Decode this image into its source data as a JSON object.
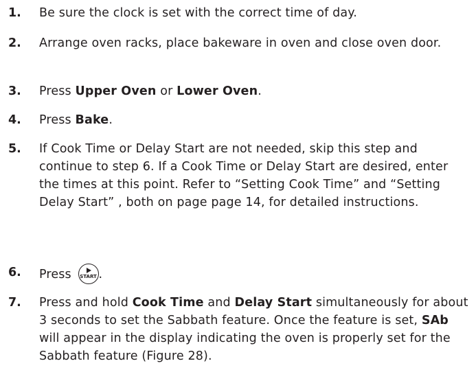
{
  "steps": [
    {
      "number": "1.",
      "text": "Be sure the clock is set with the correct time of day."
    },
    {
      "number": "2.",
      "text": "Arrange oven racks, place bakeware in oven and close oven door."
    },
    {
      "number": "3.",
      "text_before": "Press ",
      "bold_1": "Upper Oven",
      "text_mid": " or ",
      "bold_2": "Lower Oven",
      "text_after": "."
    },
    {
      "number": "4.",
      "text_before": "Press ",
      "bold": "Bake",
      "text_after": "."
    },
    {
      "number": "5.",
      "text": "If Cook Time or Delay Start are not needed, skip this step and continue to step 6. If a Cook Time or Delay Start are desired, enter the times at this point. Refer to “Setting Cook Time” and “Setting Delay Start” , both on page page 14, for detailed instructions."
    },
    {
      "number": "6.",
      "text_before": "Press ",
      "button_label": "START",
      "text_after": "."
    },
    {
      "number": "7.",
      "text_1": "Press and hold ",
      "bold_1": "Cook Time",
      "text_2": " and ",
      "bold_2": "Delay Start",
      "text_3": " simultaneously for about 3 seconds to set the Sabbath feature. Once the feature is set, ",
      "bold_3": "SAb",
      "text_4": " will appear in the display indicating the oven is properly set for the Sabbath feature (Figure 28)."
    }
  ]
}
